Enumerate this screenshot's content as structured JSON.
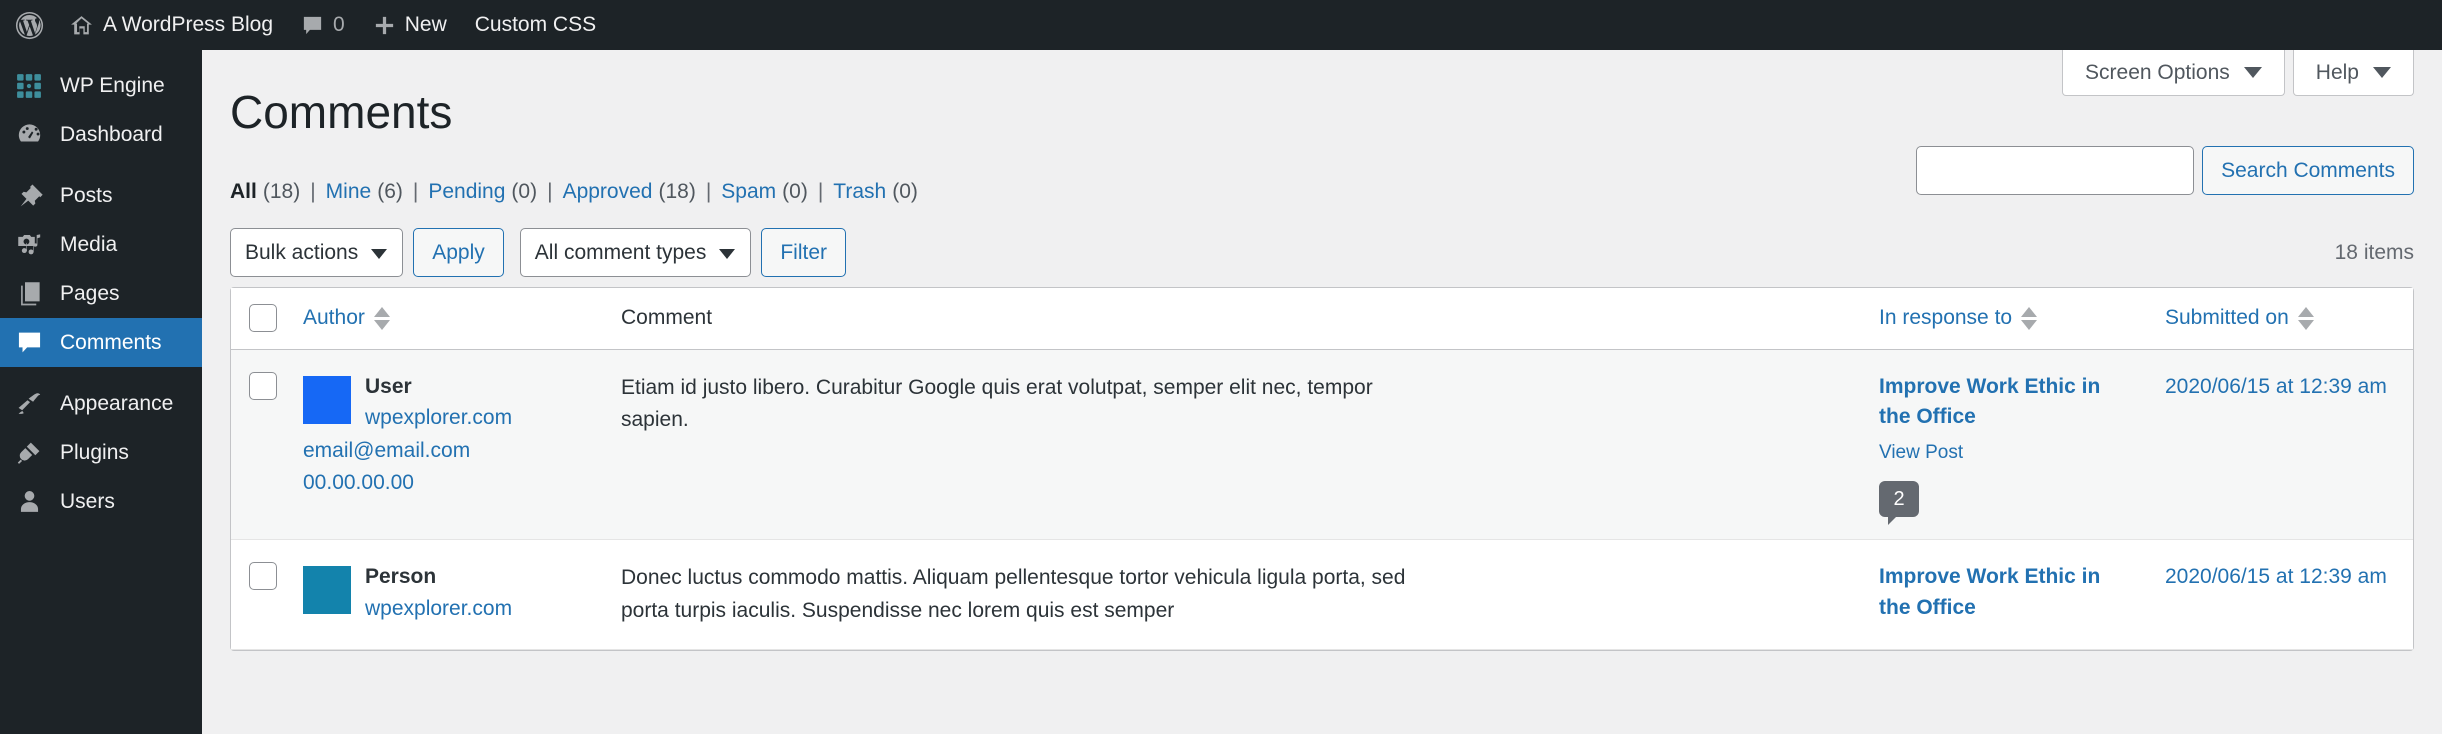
{
  "adminbar": {
    "wp_logo": "wordpress-logo-icon",
    "site_name": "A WordPress Blog",
    "comments_icon": "comment-bubble-icon",
    "comments_count": "0",
    "new_icon": "plus-icon",
    "new_label": "New",
    "custom_css_label": "Custom CSS"
  },
  "sidebar": {
    "items": [
      {
        "label": "WP Engine",
        "icon": "wp-engine-icon",
        "current": false
      },
      {
        "label": "Dashboard",
        "icon": "dashboard-gauge-icon",
        "current": false
      },
      {
        "label": "Posts",
        "icon": "pin-icon",
        "current": false
      },
      {
        "label": "Media",
        "icon": "media-camera-music-icon",
        "current": false
      },
      {
        "label": "Pages",
        "icon": "pages-icon",
        "current": false
      },
      {
        "label": "Comments",
        "icon": "comment-bubble-icon",
        "current": true
      },
      {
        "label": "Appearance",
        "icon": "paintbrush-icon",
        "current": false
      },
      {
        "label": "Plugins",
        "icon": "plug-icon",
        "current": false
      },
      {
        "label": "Users",
        "icon": "user-icon",
        "current": false
      }
    ]
  },
  "screen_meta": {
    "screen_options_label": "Screen Options",
    "help_label": "Help",
    "caret_icon": "caret-down-icon"
  },
  "page": {
    "title": "Comments"
  },
  "filters": {
    "items": [
      {
        "label": "All",
        "count": "(18)",
        "current": true
      },
      {
        "label": "Mine",
        "count": "(6)",
        "current": false
      },
      {
        "label": "Pending",
        "count": "(0)",
        "current": false
      },
      {
        "label": "Approved",
        "count": "(18)",
        "current": false
      },
      {
        "label": "Spam",
        "count": "(0)",
        "current": false
      },
      {
        "label": "Trash",
        "count": "(0)",
        "current": false
      }
    ],
    "separator": "|"
  },
  "search": {
    "value": "",
    "placeholder": "",
    "button_label": "Search Comments"
  },
  "tablenav": {
    "bulk_actions_label": "Bulk actions",
    "apply_label": "Apply",
    "comment_types_label": "All comment types",
    "filter_label": "Filter",
    "displaying_num": "18 items"
  },
  "table": {
    "columns": {
      "cb": "select-all-checkbox",
      "author": "Author",
      "comment": "Comment",
      "response": "In response to",
      "date": "Submitted on"
    },
    "rows": [
      {
        "avatar_color": "#1668f5",
        "author_name": "User",
        "author_site": "wpexplorer.com",
        "author_email": "email@email.com",
        "author_ip": "00.00.00.00",
        "comment": "Etiam id justo libero. Curabitur Google quis erat volutpat, semper elit nec, tempor sapien.",
        "response_post": "Improve Work Ethic in the Office",
        "view_post_label": "View Post",
        "comment_count": "2",
        "submitted_on": "2020/06/15 at 12:39 am"
      },
      {
        "avatar_color": "#1383ac",
        "author_name": "Person",
        "author_site": "wpexplorer.com",
        "author_email": "",
        "author_ip": "",
        "comment": "Donec luctus commodo mattis. Aliquam pellentesque tortor vehicula ligula porta, sed porta turpis iaculis. Suspendisse nec lorem quis est semper",
        "response_post": "Improve Work Ethic in the Office",
        "view_post_label": "",
        "comment_count": "",
        "submitted_on": "2020/06/15 at 12:39 am"
      }
    ]
  },
  "colors": {
    "admin_dark": "#1d2327",
    "accent_blue": "#2271b1",
    "link_blue": "#2271b1",
    "body_bg": "#f0f0f1",
    "wpengine_teal": "#3e8e9c"
  }
}
